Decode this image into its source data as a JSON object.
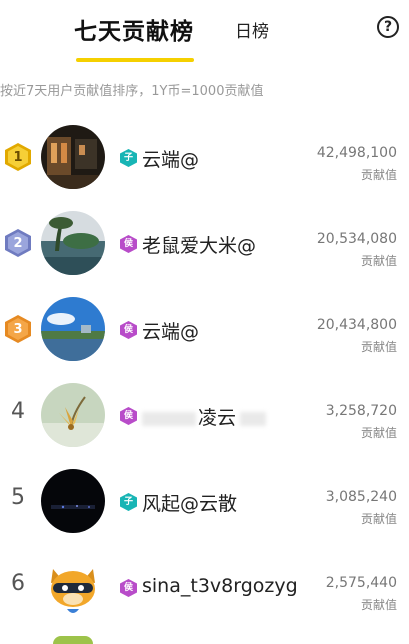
{
  "tabs": {
    "active": "七天贡献榜",
    "daily": "日榜"
  },
  "subtitle": "按近7天用户贡献值排序，1Y币=1000贡献值",
  "help_symbol": "?",
  "rows": [
    {
      "rank": "1",
      "name": "云端@",
      "score": "42,498,100",
      "score_label": "贡献值",
      "level": "子",
      "level_color": "#18b5b5",
      "badge_color": "#f3c428",
      "badge_text_color": "#6b4d00",
      "avatar": "night-building"
    },
    {
      "rank": "2",
      "name": "老鼠爱大米@",
      "score": "20,534,080",
      "score_label": "贡献值",
      "level": "侯",
      "level_color": "#b84cc9",
      "badge_color": "#8f9ad6",
      "badge_text_color": "#ffffff",
      "avatar": "palm-lake"
    },
    {
      "rank": "3",
      "name": "云端@",
      "score": "20,434,800",
      "score_label": "贡献值",
      "level": "侯",
      "level_color": "#b84cc9",
      "badge_color": "#f1a041",
      "badge_text_color": "#ffffff",
      "avatar": "blue-sky-lake"
    },
    {
      "rank": "4",
      "name": "凌云",
      "score": "3,258,720",
      "score_label": "贡献值",
      "level": "侯",
      "level_color": "#b84cc9",
      "avatar": "flower"
    },
    {
      "rank": "5",
      "name": "风起@云散",
      "score": "3,085,240",
      "score_label": "贡献值",
      "level": "子",
      "level_color": "#18b5b5",
      "avatar": "night-dark"
    },
    {
      "rank": "6",
      "name": "sina_t3v8rgozyg",
      "score": "2,575,440",
      "score_label": "贡献值",
      "level": "侯",
      "level_color": "#b84cc9",
      "avatar": "raccoon-mascot"
    }
  ]
}
